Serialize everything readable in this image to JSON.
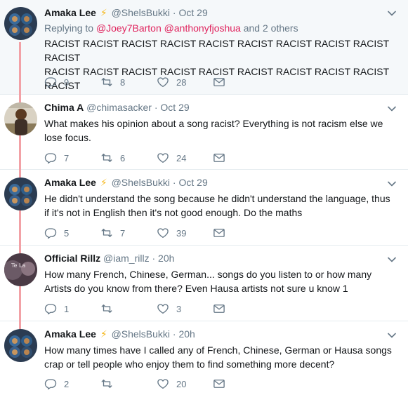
{
  "tweets": [
    {
      "name": "Amaka Lee",
      "handle": "@ShelsBukki",
      "date": "Oct 29",
      "replying_prefix": "Replying to",
      "mention1": "@Joey7Barton",
      "mention2": "@anthonyfjoshua",
      "replying_suffix": "and 2 others",
      "line1": "RACIST RACIST RACIST RACIST RACIST RACIST RACIST RACIST RACIST RACIST",
      "line2": "RACIST RACIST RACIST RACIST RACIST RACIST RACIST RACIST RACIST RACIST",
      "replies": "9",
      "retweets": "8",
      "likes": "28"
    },
    {
      "name": "Chima A",
      "handle": "@chimasacker",
      "date": "Oct 29",
      "line1": "What makes his opinion about a song racist? Everything is not racism else we",
      "line2": "lose focus.",
      "replies": "7",
      "retweets": "6",
      "likes": "24"
    },
    {
      "name": "Amaka Lee",
      "handle": "@ShelsBukki",
      "date": "Oct 29",
      "line1": "He didn't understand the song because he didn't understand the language, thus",
      "line2": "if it's not in English then it's not good enough. Do the maths",
      "replies": "5",
      "retweets": "7",
      "likes": "39"
    },
    {
      "name": "Official Rillz",
      "handle": "@iam_rillz",
      "date": "20h",
      "line1": "How many French, Chinese, German... songs do you listen to or how many",
      "line2": "Artists do you know from there? Even Hausa artists not sure u know 1",
      "replies": "1",
      "retweets": "",
      "likes": "3"
    },
    {
      "name": "Amaka Lee",
      "handle": "@ShelsBukki",
      "date": "20h",
      "line1": "How many times have I called any of French, Chinese, German or Hausa songs",
      "line2": "crap or tell people who enjoy them to find something more decent?",
      "replies": "2",
      "retweets": "",
      "likes": "20"
    }
  ],
  "icons": {
    "reply": "reply-icon",
    "retweet": "retweet-icon",
    "like": "heart-icon",
    "dm": "envelope-icon",
    "caret": "chevron-down-icon",
    "verified_bolt": "lightning-icon"
  },
  "colors": {
    "thread_line": "#f2a1a6",
    "mention": "#e0245e",
    "muted": "#657786",
    "bolt": "#f5b81c",
    "highlight_bg": "#f5f8fa"
  },
  "glyphs": {
    "bolt": "⚡"
  }
}
